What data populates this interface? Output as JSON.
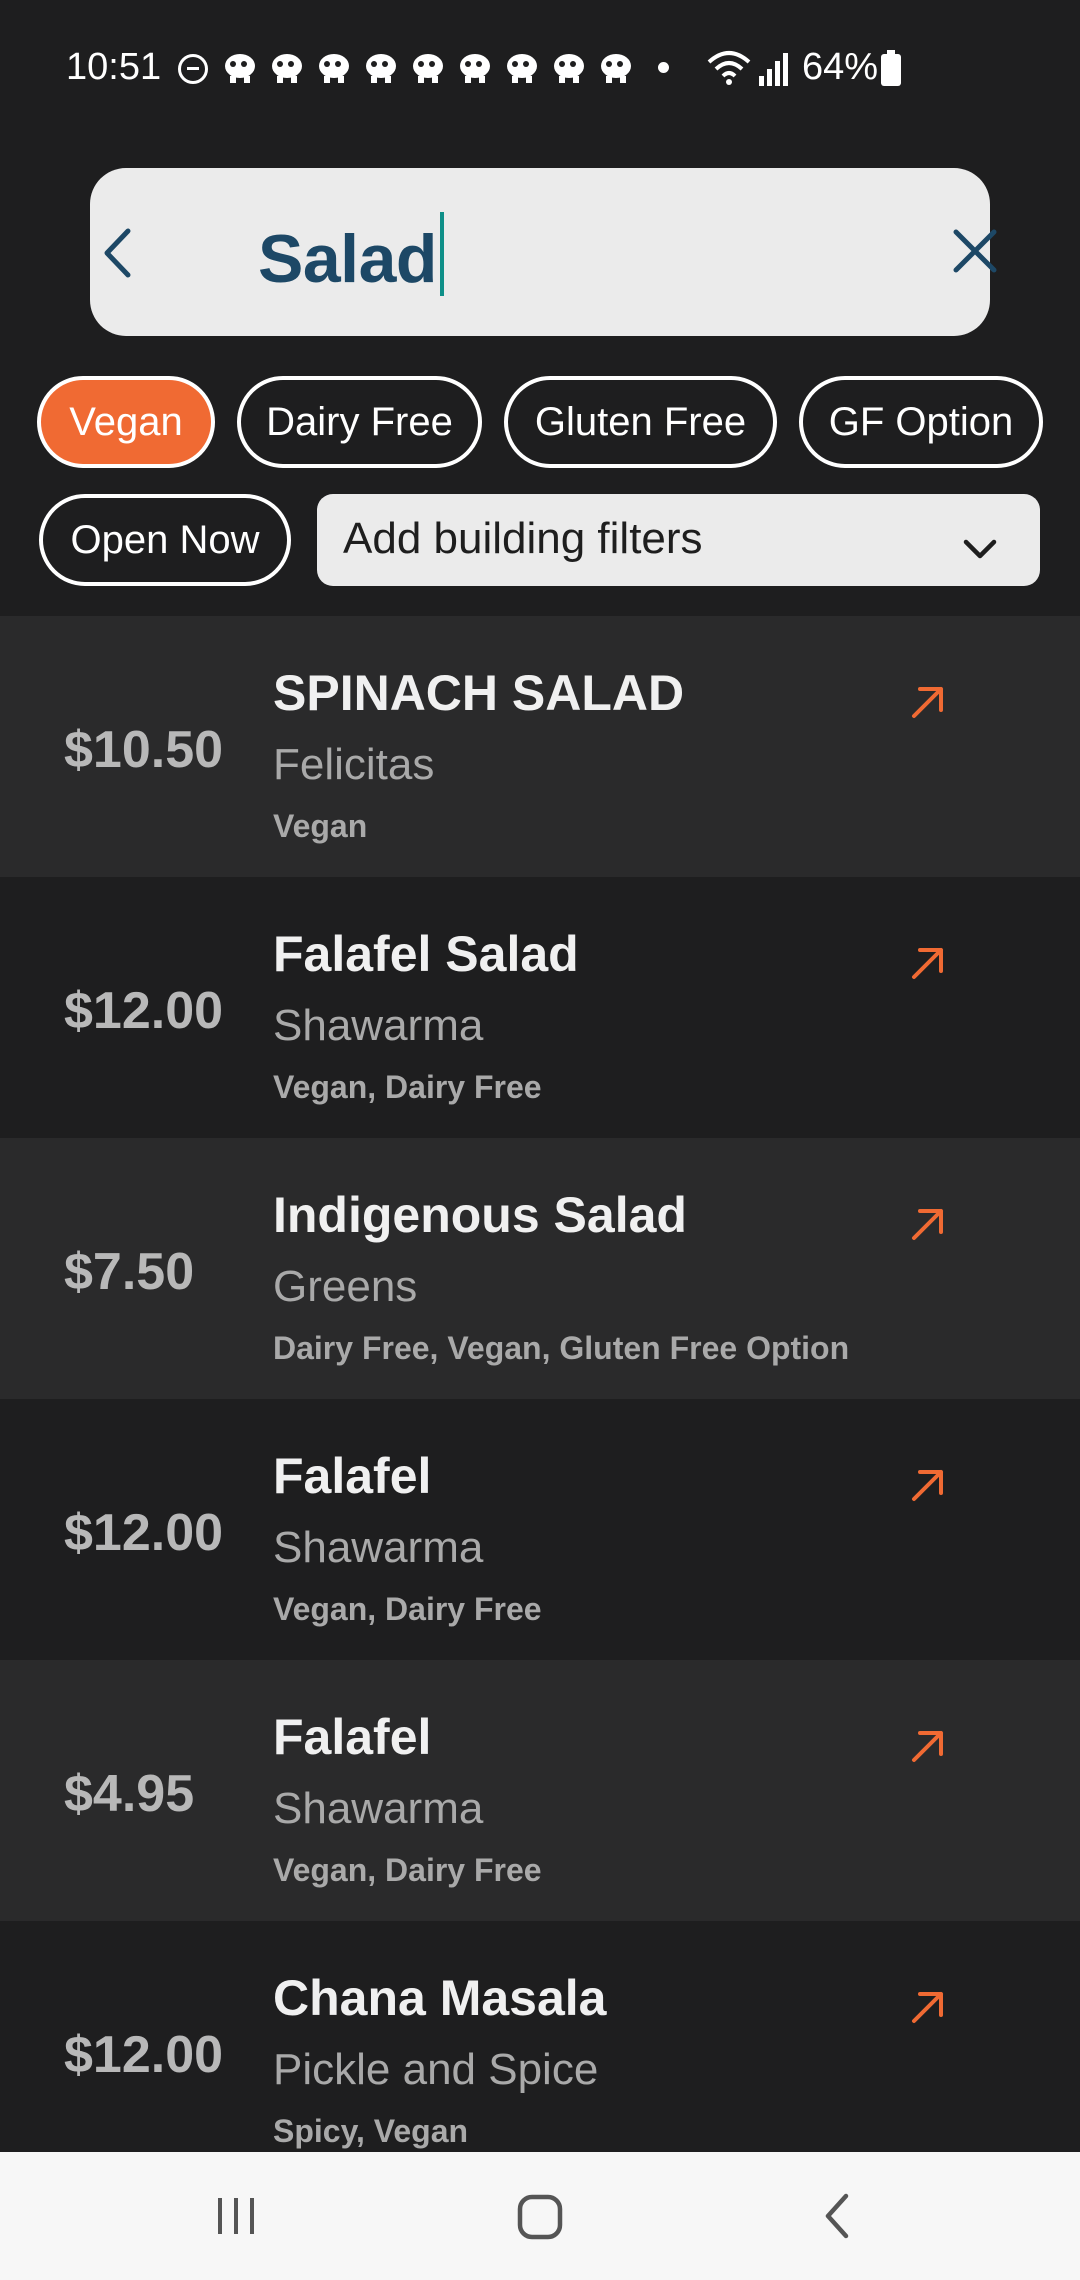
{
  "status_bar": {
    "time": "10:51",
    "battery": "64%",
    "icons": [
      "do-not-disturb-icon",
      "notification-icon",
      "wifi-icon",
      "signal-icon",
      "battery-icon"
    ]
  },
  "search": {
    "query": "Salad",
    "back_icon": "chevron-left-icon",
    "clear_icon": "close-icon"
  },
  "filters": {
    "chips": [
      {
        "label": "Vegan",
        "active": true
      },
      {
        "label": "Dairy Free",
        "active": false
      },
      {
        "label": "Gluten Free",
        "active": false
      },
      {
        "label": "GF Option",
        "active": false
      },
      {
        "label": "Open Now",
        "active": false
      }
    ],
    "building_select": {
      "label": "Add building filters",
      "icon": "chevron-down-icon"
    }
  },
  "results": [
    {
      "price": "$10.50",
      "name": "SPINACH SALAD",
      "venue": "Felicitas",
      "tags": "Vegan"
    },
    {
      "price": "$12.00",
      "name": "Falafel Salad",
      "venue": "Shawarma",
      "tags": "Vegan, Dairy Free"
    },
    {
      "price": "$7.50",
      "name": "Indigenous Salad",
      "venue": "Greens",
      "tags": "Dairy Free, Vegan, Gluten Free Option"
    },
    {
      "price": "$12.00",
      "name": "Falafel",
      "venue": "Shawarma",
      "tags": "Vegan, Dairy Free"
    },
    {
      "price": "$4.95",
      "name": "Falafel",
      "venue": "Shawarma",
      "tags": "Vegan, Dairy Free"
    },
    {
      "price": "$12.00",
      "name": "Chana Masala",
      "venue": "Pickle and Spice",
      "tags": "Spicy, Vegan"
    }
  ],
  "colors": {
    "accent": "#f06a33",
    "background": "#1e1e1f",
    "row_alt": "#2a2a2b",
    "search_text": "#1d4866"
  },
  "nav_bar": {
    "icons": [
      "recent-apps-icon",
      "home-icon",
      "back-icon"
    ]
  }
}
